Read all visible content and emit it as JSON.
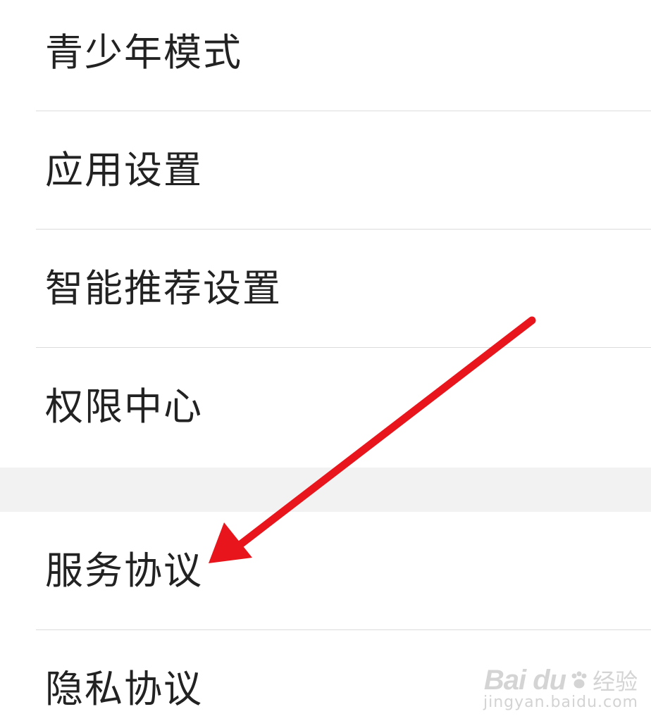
{
  "menu": {
    "group_1": [
      {
        "label": "青少年模式"
      },
      {
        "label": "应用设置"
      },
      {
        "label": "智能推荐设置"
      },
      {
        "label": "权限中心"
      }
    ],
    "group_2": [
      {
        "label": "服务协议"
      },
      {
        "label": "隐私协议"
      }
    ]
  },
  "annotation": {
    "arrow_color": "#e8161c",
    "target": "服务协议"
  },
  "watermark": {
    "brand": "Bai du",
    "brand_cn": "经验",
    "url": "jingyan.baidu.com"
  },
  "colors": {
    "background": "#ffffff",
    "section_gap": "#f2f2f2",
    "divider": "#dcdcdc",
    "text": "#222222"
  }
}
